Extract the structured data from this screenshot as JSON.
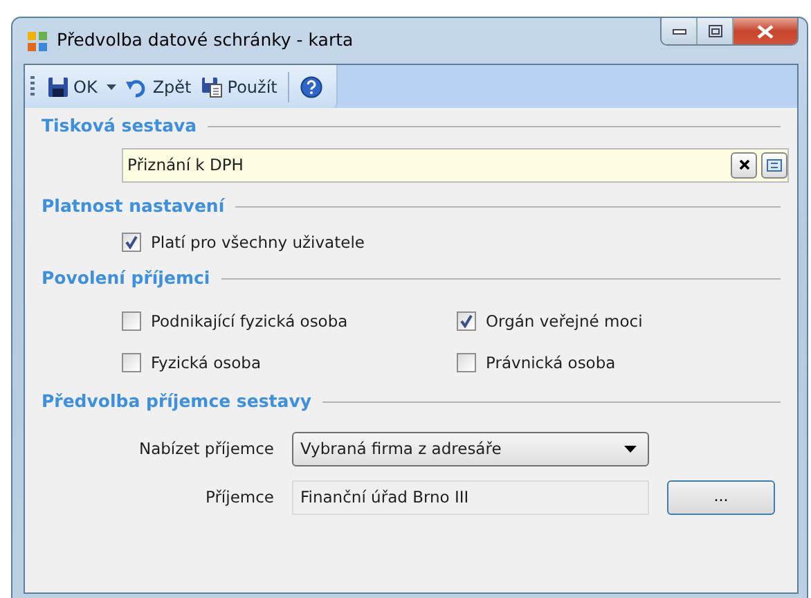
{
  "window": {
    "title": "Předvolba datové schránky - karta"
  },
  "toolbar": [
    {
      "kind": "save",
      "label": "OK",
      "dropdown": true
    },
    {
      "kind": "undo",
      "label": "Zpět",
      "dropdown": false
    },
    {
      "kind": "apply",
      "label": "Použít",
      "dropdown": false
    },
    {
      "kind": "help",
      "dropdown": false
    }
  ],
  "sections": [
    {
      "heading": "Tisková sestava",
      "kind": "lookup",
      "value": "Přiznání k DPH"
    },
    {
      "heading": "Platnost nastavení",
      "kind": "checks",
      "checkboxes": [
        {
          "label": "Platí pro všechny uživatele",
          "checked": true
        }
      ]
    },
    {
      "heading": "Povolení příjemci",
      "kind": "grid",
      "checkboxes": [
        {
          "label": "Podnikající fyzická osoba",
          "checked": false
        },
        {
          "label": "Orgán veřejné moci",
          "checked": true
        },
        {
          "label": "Fyzická osoba",
          "checked": false
        },
        {
          "label": "Právnická osoba",
          "checked": false
        }
      ]
    },
    {
      "heading": "Předvolba příjemce sestavy",
      "kind": "form",
      "rows": [
        {
          "kind": "select",
          "label": "Nabízet příjemce",
          "value": "Vybraná firma z adresáře"
        },
        {
          "kind": "text",
          "label": "Příjemce",
          "value": "Finanční úřad Brno III",
          "button": "..."
        }
      ]
    }
  ]
}
